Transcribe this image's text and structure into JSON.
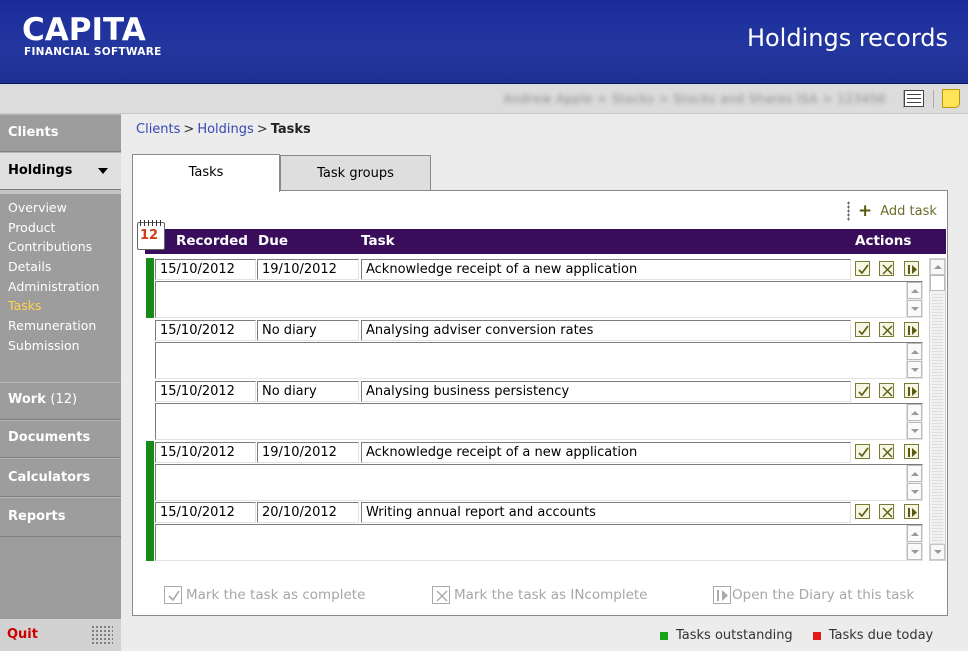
{
  "header": {
    "logo_main": "CAPITA",
    "logo_sub": "FINANCIAL SOFTWARE",
    "title": "Holdings records"
  },
  "context_bar": {
    "client_context": "Andrew Apple > Stocks > Stocks and Shares ISA > 123456",
    "icons": [
      "list-icon",
      "note-icon"
    ]
  },
  "sidebar": {
    "clients": "Clients",
    "holdings": "Holdings",
    "holdings_items": [
      "Overview",
      "Product",
      "Contributions",
      "Details",
      "Administration",
      "Tasks",
      "Remuneration",
      "Submission"
    ],
    "active_item": "Tasks",
    "work": "Work",
    "work_count": "(12)",
    "documents": "Documents",
    "calculators": "Calculators",
    "reports": "Reports",
    "quit": "Quit"
  },
  "breadcrumb": {
    "clients": "Clients",
    "holdings": "Holdings",
    "separator": ">",
    "current": "Tasks"
  },
  "tabs": {
    "tasks": "Tasks",
    "task_groups": "Task groups"
  },
  "toolbar": {
    "add_task": "Add task",
    "calendar_number": "12"
  },
  "table": {
    "columns": {
      "recorded": "Recorded",
      "due": "Due",
      "task": "Task",
      "actions": "Actions"
    },
    "rows": [
      {
        "recorded": "15/10/2012",
        "due": "19/10/2012",
        "task": "Acknowledge receipt of a new application",
        "status": "outstanding"
      },
      {
        "recorded": "15/10/2012",
        "due": "No diary",
        "task": "Analysing adviser conversion rates",
        "status": "none"
      },
      {
        "recorded": "15/10/2012",
        "due": "No diary",
        "task": "Analysing business persistency",
        "status": "none"
      },
      {
        "recorded": "15/10/2012",
        "due": "19/10/2012",
        "task": "Acknowledge receipt of a new application",
        "status": "outstanding"
      },
      {
        "recorded": "15/10/2012",
        "due": "20/10/2012",
        "task": "Writing annual report and accounts",
        "status": "outstanding"
      }
    ]
  },
  "legend": {
    "complete": "Mark the task as complete",
    "incomplete": "Mark the task as INcomplete",
    "diary": "Open the Diary at this task",
    "outstanding": "Tasks outstanding",
    "due_today": "Tasks due today"
  },
  "colors": {
    "header_bg": "#1f3199",
    "table_header_bg": "#3a0d5c",
    "outstanding": "#19a319",
    "due_today": "#e21a1a",
    "active_nav": "#ffd24a"
  }
}
